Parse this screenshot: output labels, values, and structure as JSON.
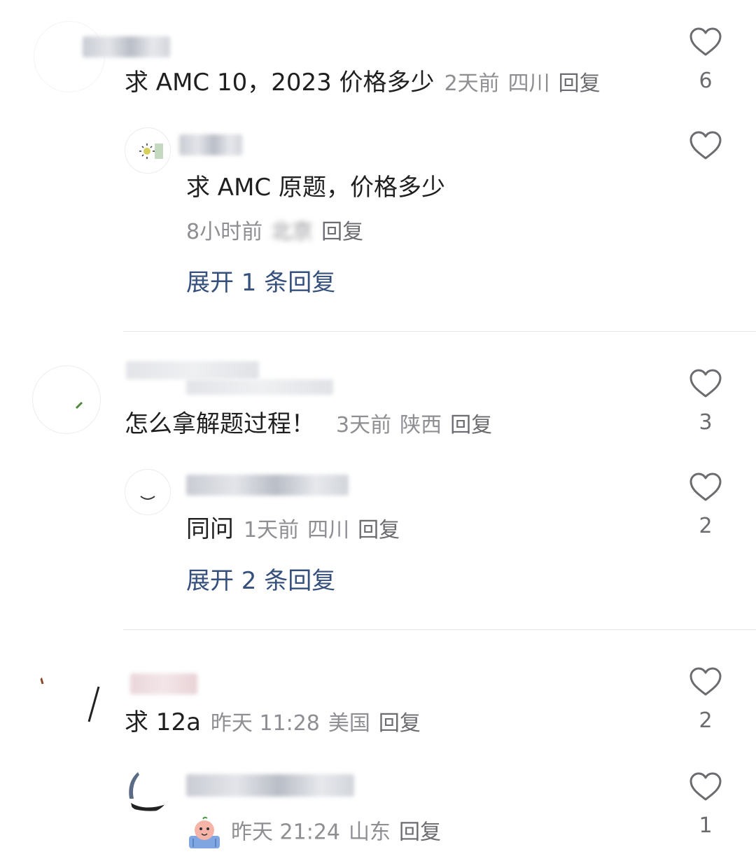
{
  "comments": [
    {
      "text": "求 AMC 10，2023 价格多少",
      "time": "2天前",
      "location": "四川",
      "reply_label": "回复",
      "likes": "6",
      "replies": [
        {
          "text": "求 AMC 原题，价格多少",
          "time": "8小时前",
          "location": "北京",
          "reply_label": "回复",
          "likes": ""
        }
      ],
      "expand_label": "展开 1 条回复"
    },
    {
      "text": "怎么拿解题过程！",
      "time": "3天前",
      "location": "陕西",
      "reply_label": "回复",
      "likes": "3",
      "replies": [
        {
          "text": "同问",
          "time": "1天前",
          "location": "四川",
          "reply_label": "回复",
          "likes": "2"
        }
      ],
      "expand_label": "展开 2 条回复"
    },
    {
      "text": "求 12a",
      "time": "昨天 11:28",
      "location": "美国",
      "reply_label": "回复",
      "likes": "2",
      "replies": [
        {
          "text": "",
          "time": "昨天 21:24",
          "location": "山东",
          "reply_label": "回复",
          "likes": "1",
          "emoji": "crying-face-sticker"
        }
      ]
    }
  ],
  "colors": {
    "expand_link": "#36507d",
    "meta_text": "#8e8e93",
    "heart_stroke": "#6b6b70"
  }
}
